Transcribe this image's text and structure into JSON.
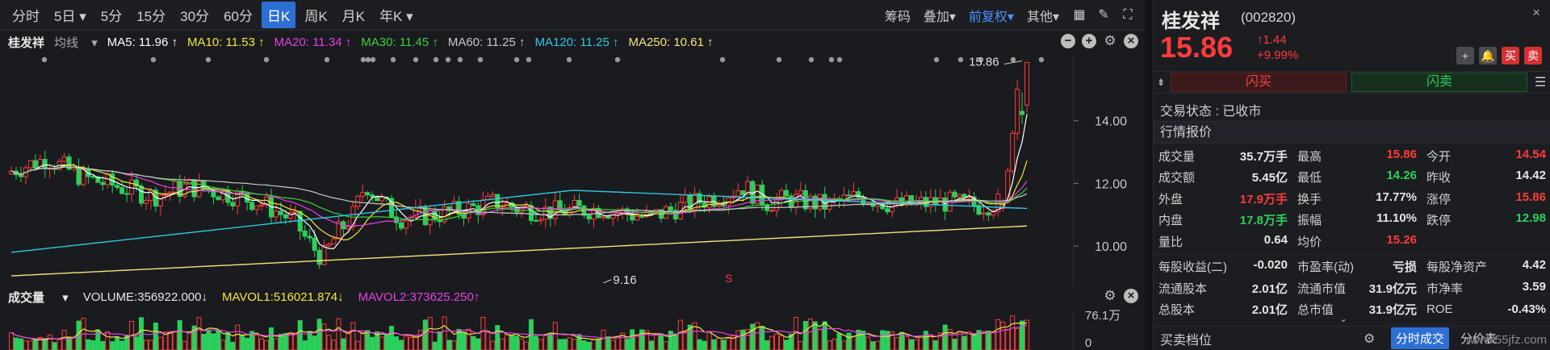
{
  "toolbar": {
    "periods": [
      "分时",
      "5日",
      "5分",
      "15分",
      "30分",
      "60分",
      "日K",
      "周K",
      "月K",
      "年K"
    ],
    "active_period": "日K",
    "dropdown_periods": [
      "5日",
      "年K"
    ],
    "right_items": [
      "筹码",
      "叠加",
      "前复权",
      "其他"
    ],
    "right_dropdowns": [
      "叠加",
      "前复权",
      "其他"
    ]
  },
  "ma_legend": {
    "name": "桂发祥",
    "type": "均线",
    "items": [
      {
        "label": "MA5: 11.96 ↑",
        "color": "#ffffff"
      },
      {
        "label": "MA10: 11.53 ↑",
        "color": "#f2e640"
      },
      {
        "label": "MA20: 11.34 ↑",
        "color": "#e640e6"
      },
      {
        "label": "MA30: 11.45 ↑",
        "color": "#3ad23a"
      },
      {
        "label": "MA60: 11.25 ↑",
        "color": "#c8c8c8"
      },
      {
        "label": "MA120: 11.25 ↑",
        "color": "#2ec8e0"
      },
      {
        "label": "MA250: 10.61 ↑",
        "color": "#f5e27a"
      }
    ]
  },
  "price_axis": {
    "labels": [
      "14.00",
      "12.00",
      "10.00"
    ]
  },
  "annotations": {
    "high": "15.86",
    "low": "9.16",
    "marker": "S"
  },
  "volume_legend": {
    "name": "成交量",
    "volume": "VOLUME:356922.000↓",
    "mavol1": "MAVOL1:516021.874↓",
    "mavol2": "MAVOL2:373625.250↑",
    "axis_top": "76.1万",
    "axis_bottom": "0"
  },
  "chart_data": {
    "type": "candlestick",
    "ylim": [
      9.0,
      16.0
    ],
    "y_ticks": [
      10,
      12,
      14
    ],
    "last_close": 15.86,
    "period_high": 15.86,
    "period_low": 9.16
  },
  "stock": {
    "name": "桂发祥",
    "code": "(002820)",
    "price": "15.86",
    "change": "↑1.44",
    "pct": "+9.99%",
    "buttons": [
      "+",
      "🔔",
      "买",
      "卖"
    ]
  },
  "flash": {
    "buy": "闪买",
    "sell": "闪卖"
  },
  "status": "交易状态 : 已收市",
  "quote_title": "行情报价",
  "quote_rows": [
    [
      {
        "k": "成交量",
        "v": "35.7万手",
        "c": "white"
      },
      {
        "k": "最高",
        "v": "15.86",
        "c": "red"
      },
      {
        "k": "今开",
        "v": "14.54",
        "c": "red"
      }
    ],
    [
      {
        "k": "成交额",
        "v": "5.45亿",
        "c": "white"
      },
      {
        "k": "最低",
        "v": "14.26",
        "c": "green"
      },
      {
        "k": "昨收",
        "v": "14.42",
        "c": "white"
      }
    ],
    [
      {
        "k": "外盘",
        "v": "17.9万手",
        "c": "red"
      },
      {
        "k": "换手",
        "v": "17.77%",
        "c": "white"
      },
      {
        "k": "涨停",
        "v": "15.86",
        "c": "red"
      }
    ],
    [
      {
        "k": "内盘",
        "v": "17.8万手",
        "c": "green"
      },
      {
        "k": "振幅",
        "v": "11.10%",
        "c": "white"
      },
      {
        "k": "跌停",
        "v": "12.98",
        "c": "green"
      }
    ],
    [
      {
        "k": "量比",
        "v": "0.64",
        "c": "white"
      },
      {
        "k": "均价",
        "v": "15.26",
        "c": "red"
      },
      {
        "k": "",
        "v": "",
        "c": "white"
      }
    ],
    [
      {
        "k": "每股收益(二)",
        "v": "-0.020",
        "c": "white"
      },
      {
        "k": "市盈率(动)",
        "v": "亏损",
        "c": "white"
      },
      {
        "k": "每股净资产",
        "v": "4.42",
        "c": "white"
      }
    ],
    [
      {
        "k": "流通股本",
        "v": "2.01亿",
        "c": "white"
      },
      {
        "k": "流通市值",
        "v": "31.9亿元",
        "c": "white"
      },
      {
        "k": "市净率",
        "v": "3.59",
        "c": "white"
      }
    ],
    [
      {
        "k": "总股本",
        "v": "2.01亿",
        "c": "white"
      },
      {
        "k": "总市值",
        "v": "31.9亿元",
        "c": "white"
      },
      {
        "k": "ROE",
        "v": "-0.43%",
        "c": "white"
      }
    ]
  ],
  "bottom": {
    "title": "买卖档位",
    "tab_active": "分时成交",
    "tab_other": "分价表"
  },
  "watermark": "www.55jfz.com"
}
